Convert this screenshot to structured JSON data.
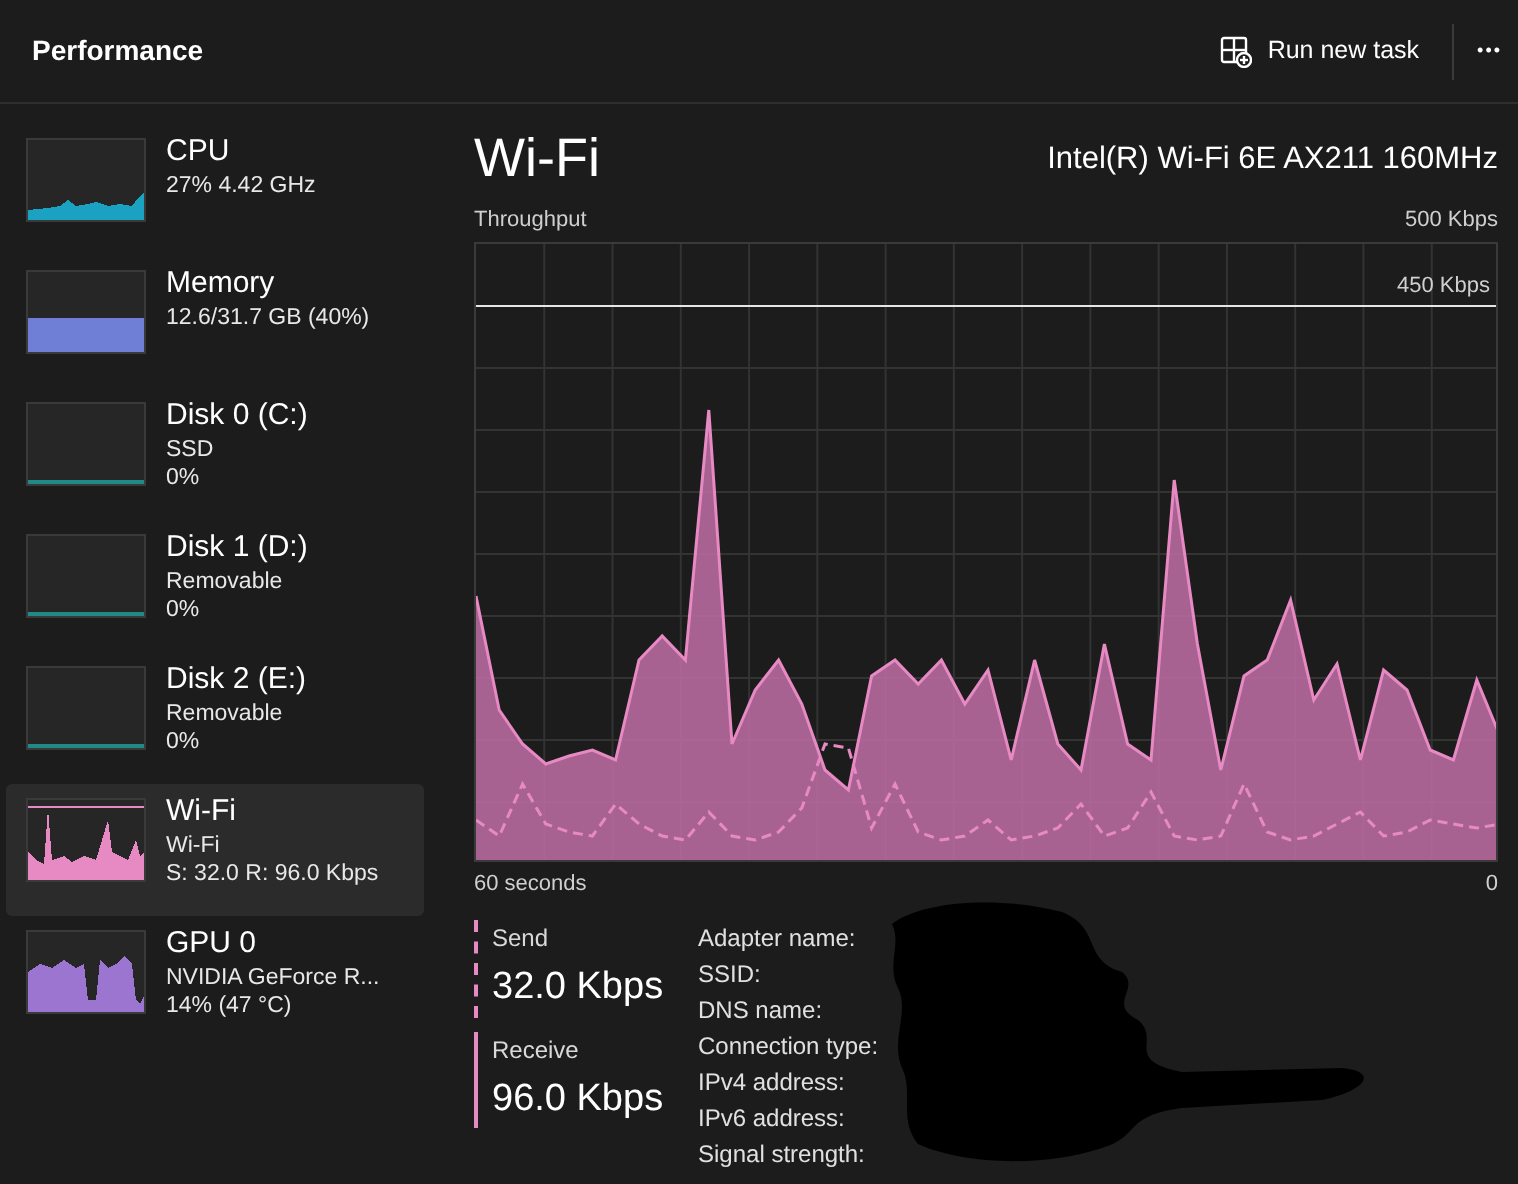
{
  "header": {
    "title": "Performance",
    "run_task_label": "Run new task",
    "more_label": "•••"
  },
  "sidebar": {
    "items": [
      {
        "kind": "cpu",
        "name": "CPU",
        "lines": [
          "27% 4.42 GHz"
        ],
        "color": "#1ba1c1",
        "selected": false
      },
      {
        "kind": "memory",
        "name": "Memory",
        "lines": [
          "12.6/31.7 GB (40%)"
        ],
        "color": "#6f7fd6",
        "selected": false
      },
      {
        "kind": "disk",
        "name": "Disk 0 (C:)",
        "lines": [
          "SSD",
          "0%"
        ],
        "color": "#1f8a86",
        "selected": false
      },
      {
        "kind": "disk",
        "name": "Disk 1 (D:)",
        "lines": [
          "Removable",
          "0%"
        ],
        "color": "#1f8a86",
        "selected": false
      },
      {
        "kind": "disk",
        "name": "Disk 2 (E:)",
        "lines": [
          "Removable",
          "0%"
        ],
        "color": "#1f8a86",
        "selected": false
      },
      {
        "kind": "wifi",
        "name": "Wi-Fi",
        "lines": [
          "Wi-Fi",
          "S: 32.0 R: 96.0 Kbps"
        ],
        "color": "#e78ac3",
        "selected": true
      },
      {
        "kind": "gpu",
        "name": "GPU 0",
        "lines": [
          "NVIDIA GeForce R...",
          "14% (47 °C)"
        ],
        "color": "#9b75cf",
        "selected": false
      }
    ]
  },
  "detail": {
    "title": "Wi-Fi",
    "adapter": "Intel(R) Wi-Fi 6E AX211 160MHz",
    "graph": {
      "label": "Throughput",
      "max_label": "500 Kbps",
      "scale_label": "450 Kbps",
      "x_start": "60 seconds",
      "x_end": "0"
    },
    "stats": [
      {
        "label": "Send",
        "value": "32.0 Kbps",
        "dashed": true
      },
      {
        "label": "Receive",
        "value": "96.0 Kbps",
        "dashed": false
      }
    ],
    "properties": [
      "Adapter name:",
      "SSID:",
      "DNS name:",
      "Connection type:",
      "IPv4 address:",
      "IPv6 address:",
      "Signal strength:"
    ]
  }
}
